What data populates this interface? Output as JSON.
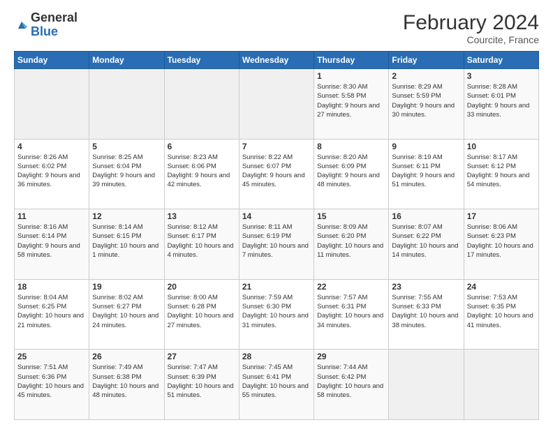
{
  "logo": {
    "general": "General",
    "blue": "Blue"
  },
  "title": "February 2024",
  "subtitle": "Courcite, France",
  "days_header": [
    "Sunday",
    "Monday",
    "Tuesday",
    "Wednesday",
    "Thursday",
    "Friday",
    "Saturday"
  ],
  "weeks": [
    [
      {
        "day": "",
        "info": ""
      },
      {
        "day": "",
        "info": ""
      },
      {
        "day": "",
        "info": ""
      },
      {
        "day": "",
        "info": ""
      },
      {
        "day": "1",
        "info": "Sunrise: 8:30 AM\nSunset: 5:58 PM\nDaylight: 9 hours and 27 minutes."
      },
      {
        "day": "2",
        "info": "Sunrise: 8:29 AM\nSunset: 5:59 PM\nDaylight: 9 hours and 30 minutes."
      },
      {
        "day": "3",
        "info": "Sunrise: 8:28 AM\nSunset: 6:01 PM\nDaylight: 9 hours and 33 minutes."
      }
    ],
    [
      {
        "day": "4",
        "info": "Sunrise: 8:26 AM\nSunset: 6:02 PM\nDaylight: 9 hours and 36 minutes."
      },
      {
        "day": "5",
        "info": "Sunrise: 8:25 AM\nSunset: 6:04 PM\nDaylight: 9 hours and 39 minutes."
      },
      {
        "day": "6",
        "info": "Sunrise: 8:23 AM\nSunset: 6:06 PM\nDaylight: 9 hours and 42 minutes."
      },
      {
        "day": "7",
        "info": "Sunrise: 8:22 AM\nSunset: 6:07 PM\nDaylight: 9 hours and 45 minutes."
      },
      {
        "day": "8",
        "info": "Sunrise: 8:20 AM\nSunset: 6:09 PM\nDaylight: 9 hours and 48 minutes."
      },
      {
        "day": "9",
        "info": "Sunrise: 8:19 AM\nSunset: 6:11 PM\nDaylight: 9 hours and 51 minutes."
      },
      {
        "day": "10",
        "info": "Sunrise: 8:17 AM\nSunset: 6:12 PM\nDaylight: 9 hours and 54 minutes."
      }
    ],
    [
      {
        "day": "11",
        "info": "Sunrise: 8:16 AM\nSunset: 6:14 PM\nDaylight: 9 hours and 58 minutes."
      },
      {
        "day": "12",
        "info": "Sunrise: 8:14 AM\nSunset: 6:15 PM\nDaylight: 10 hours and 1 minute."
      },
      {
        "day": "13",
        "info": "Sunrise: 8:12 AM\nSunset: 6:17 PM\nDaylight: 10 hours and 4 minutes."
      },
      {
        "day": "14",
        "info": "Sunrise: 8:11 AM\nSunset: 6:19 PM\nDaylight: 10 hours and 7 minutes."
      },
      {
        "day": "15",
        "info": "Sunrise: 8:09 AM\nSunset: 6:20 PM\nDaylight: 10 hours and 11 minutes."
      },
      {
        "day": "16",
        "info": "Sunrise: 8:07 AM\nSunset: 6:22 PM\nDaylight: 10 hours and 14 minutes."
      },
      {
        "day": "17",
        "info": "Sunrise: 8:06 AM\nSunset: 6:23 PM\nDaylight: 10 hours and 17 minutes."
      }
    ],
    [
      {
        "day": "18",
        "info": "Sunrise: 8:04 AM\nSunset: 6:25 PM\nDaylight: 10 hours and 21 minutes."
      },
      {
        "day": "19",
        "info": "Sunrise: 8:02 AM\nSunset: 6:27 PM\nDaylight: 10 hours and 24 minutes."
      },
      {
        "day": "20",
        "info": "Sunrise: 8:00 AM\nSunset: 6:28 PM\nDaylight: 10 hours and 27 minutes."
      },
      {
        "day": "21",
        "info": "Sunrise: 7:59 AM\nSunset: 6:30 PM\nDaylight: 10 hours and 31 minutes."
      },
      {
        "day": "22",
        "info": "Sunrise: 7:57 AM\nSunset: 6:31 PM\nDaylight: 10 hours and 34 minutes."
      },
      {
        "day": "23",
        "info": "Sunrise: 7:55 AM\nSunset: 6:33 PM\nDaylight: 10 hours and 38 minutes."
      },
      {
        "day": "24",
        "info": "Sunrise: 7:53 AM\nSunset: 6:35 PM\nDaylight: 10 hours and 41 minutes."
      }
    ],
    [
      {
        "day": "25",
        "info": "Sunrise: 7:51 AM\nSunset: 6:36 PM\nDaylight: 10 hours and 45 minutes."
      },
      {
        "day": "26",
        "info": "Sunrise: 7:49 AM\nSunset: 6:38 PM\nDaylight: 10 hours and 48 minutes."
      },
      {
        "day": "27",
        "info": "Sunrise: 7:47 AM\nSunset: 6:39 PM\nDaylight: 10 hours and 51 minutes."
      },
      {
        "day": "28",
        "info": "Sunrise: 7:45 AM\nSunset: 6:41 PM\nDaylight: 10 hours and 55 minutes."
      },
      {
        "day": "29",
        "info": "Sunrise: 7:44 AM\nSunset: 6:42 PM\nDaylight: 10 hours and 58 minutes."
      },
      {
        "day": "",
        "info": ""
      },
      {
        "day": "",
        "info": ""
      }
    ]
  ]
}
